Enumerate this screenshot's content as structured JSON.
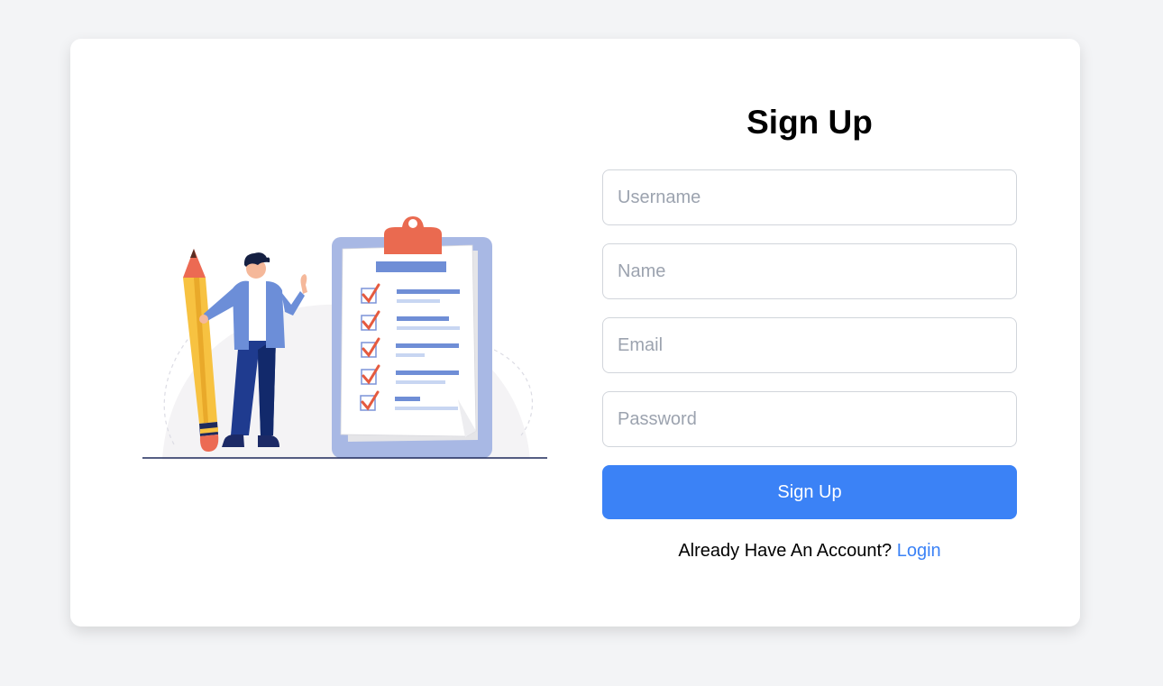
{
  "form": {
    "title": "Sign Up",
    "fields": {
      "username": {
        "placeholder": "Username",
        "value": ""
      },
      "name": {
        "placeholder": "Name",
        "value": ""
      },
      "email": {
        "placeholder": "Email",
        "value": ""
      },
      "password": {
        "placeholder": "Password",
        "value": ""
      }
    },
    "submit_label": "Sign Up",
    "footer_prompt": "Already Have An Account?",
    "login_label": "Login"
  },
  "colors": {
    "background": "#f3f4f6",
    "card": "#ffffff",
    "accent": "#3b82f6",
    "input_border": "#d1d5db",
    "placeholder": "#9ca3af"
  },
  "illustration": {
    "subject": "person-with-pencil-and-checklist-clipboard"
  }
}
